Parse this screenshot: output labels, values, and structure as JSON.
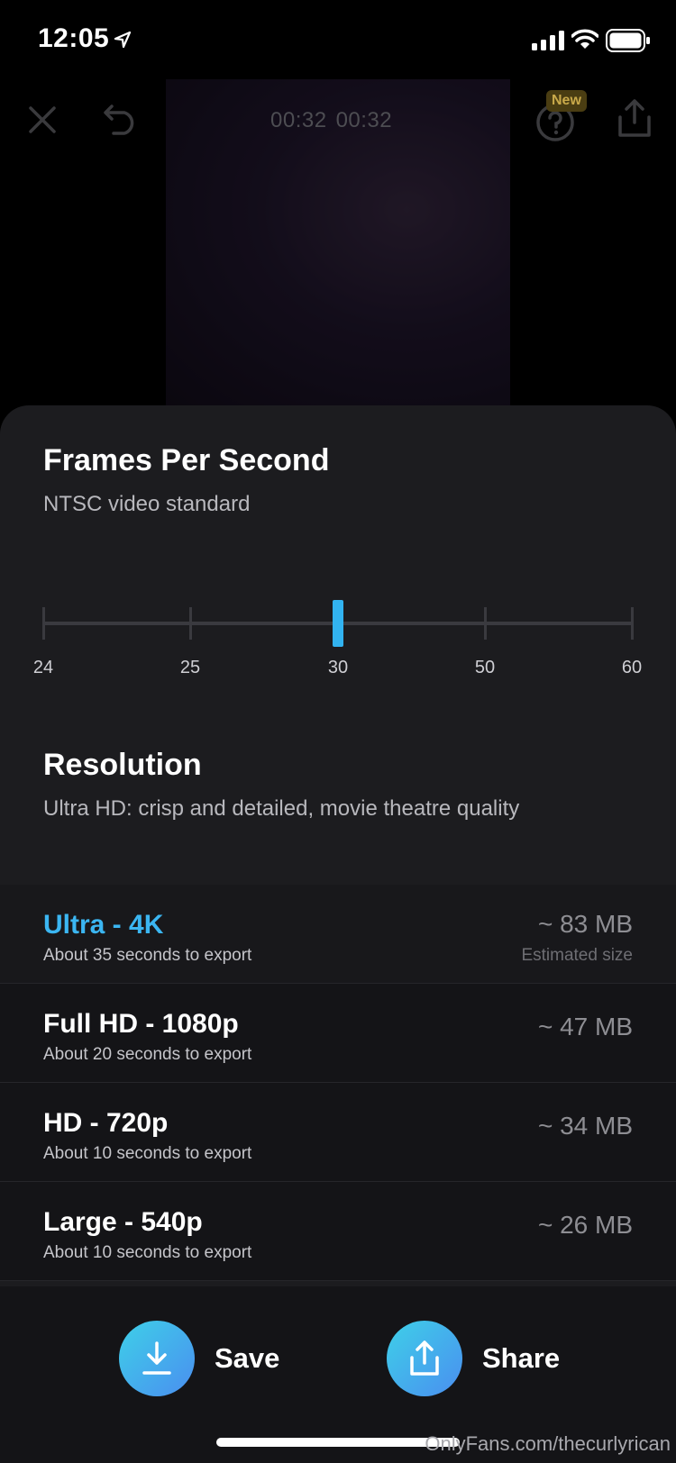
{
  "status_bar": {
    "time": "12:05"
  },
  "player": {
    "timecode_current": "00:32",
    "timecode_total": "00:32",
    "new_badge": "New"
  },
  "fps": {
    "title": "Frames Per Second",
    "subtitle": "NTSC video standard",
    "options": [
      "24",
      "25",
      "30",
      "50",
      "60"
    ],
    "selected": "30"
  },
  "resolution": {
    "title": "Resolution",
    "subtitle": "Ultra HD: crisp and detailed, movie theatre quality",
    "items": [
      {
        "name": "Ultra - 4K",
        "time": "About 35 seconds to export",
        "size": "~ 83 MB",
        "note": "Estimated size",
        "selected": true
      },
      {
        "name": "Full HD - 1080p",
        "time": "About 20 seconds to export",
        "size": "~ 47 MB"
      },
      {
        "name": "HD - 720p",
        "time": "About 10 seconds to export",
        "size": "~ 34 MB"
      },
      {
        "name": "Large - 540p",
        "time": "About 10 seconds to export",
        "size": "~ 26 MB"
      }
    ]
  },
  "actions": {
    "save_label": "Save",
    "share_label": "Share"
  },
  "watermark": "OnlyFans.com/thecurlyrican",
  "colors": {
    "accent": "#32b3f0",
    "sheet": "#1c1c1f",
    "list": "#141417"
  }
}
